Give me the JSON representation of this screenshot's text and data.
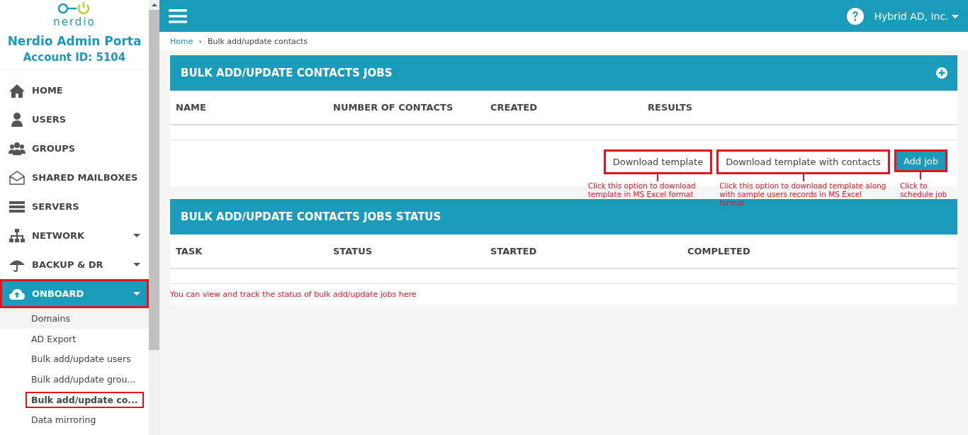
{
  "sidebar": {
    "logo_text": "nerdio",
    "title": "Nerdio Admin Porta",
    "account": "Account ID: 5104",
    "items": [
      {
        "label": "HOME",
        "has_caret": false,
        "selected": false,
        "highlighted": false
      },
      {
        "label": "USERS",
        "has_caret": false,
        "selected": false,
        "highlighted": false
      },
      {
        "label": "GROUPS",
        "has_caret": false,
        "selected": false,
        "highlighted": false
      },
      {
        "label": "SHARED MAILBOXES",
        "has_caret": false,
        "selected": false,
        "highlighted": false
      },
      {
        "label": "SERVERS",
        "has_caret": false,
        "selected": false,
        "highlighted": false
      },
      {
        "label": "NETWORK",
        "has_caret": true,
        "selected": false,
        "highlighted": false
      },
      {
        "label": "BACKUP & DR",
        "has_caret": true,
        "selected": false,
        "highlighted": false
      },
      {
        "label": "ONBOARD",
        "has_caret": true,
        "selected": true,
        "highlighted": true,
        "children": [
          {
            "label": "Domains",
            "selected": false,
            "hovered": true,
            "highlighted": false
          },
          {
            "label": "AD Export",
            "selected": false,
            "hovered": false,
            "highlighted": false
          },
          {
            "label": "Bulk add/update users",
            "selected": false,
            "hovered": false,
            "highlighted": false
          },
          {
            "label": "Bulk add/update grou...",
            "selected": false,
            "hovered": false,
            "highlighted": false
          },
          {
            "label": "Bulk add/update co...",
            "selected": true,
            "hovered": false,
            "highlighted": true
          },
          {
            "label": "Data mirroring",
            "selected": false,
            "hovered": false,
            "highlighted": false
          }
        ]
      }
    ]
  },
  "topbar": {
    "account": "Hybrid AD, Inc."
  },
  "breadcrumb": {
    "separator": "›",
    "items": [
      {
        "label": "Home",
        "link": true
      },
      {
        "label": "Bulk add/update contacts",
        "link": false
      }
    ]
  },
  "jobs_panel": {
    "title": "BULK ADD/UPDATE CONTACTS JOBS",
    "columns": [
      "NAME",
      "NUMBER OF CONTACTS",
      "CREATED",
      "RESULTS"
    ],
    "actions": [
      {
        "label": "Download template",
        "kind": "plain",
        "highlighted": true,
        "note": "Click this option to download template in MS Excel format"
      },
      {
        "label": "Download template with contacts",
        "kind": "plain",
        "highlighted": true,
        "note": "Click this option to download template along with sample users records in MS Excel format"
      },
      {
        "label": "Add job",
        "kind": "primary",
        "highlighted": true,
        "note": "Click to schedule job"
      }
    ]
  },
  "status_panel": {
    "title": "BULK ADD/UPDATE CONTACTS JOBS STATUS",
    "columns": [
      "TASK",
      "STATUS",
      "STARTED",
      "COMPLETED"
    ],
    "note": "You can view and track the status of bulk add/update jobs here"
  }
}
